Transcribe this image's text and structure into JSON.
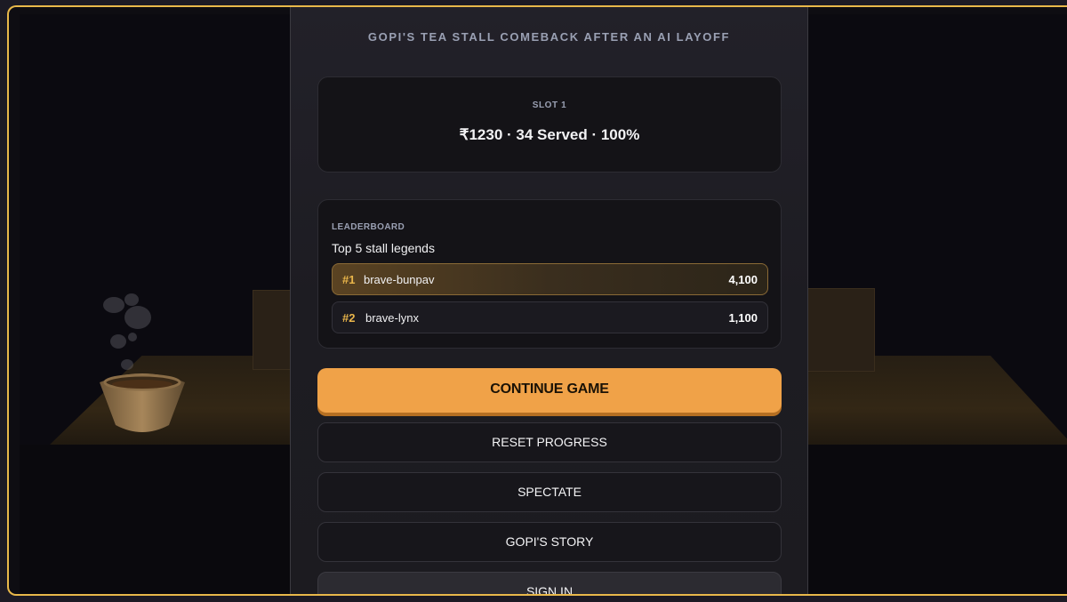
{
  "game": {
    "title": "GOPI'S TEA STALL COMEBACK AFTER AN AI LAYOFF"
  },
  "slot": {
    "label": "SLOT 1",
    "stats": "₹1230 · 34 Served · 100%"
  },
  "leaderboard": {
    "label": "LEADERBOARD",
    "subtitle": "Top 5 stall legends",
    "entries": [
      {
        "rank": "#1",
        "name": "brave-bunpav",
        "score": "4,100"
      },
      {
        "rank": "#2",
        "name": "brave-lynx",
        "score": "1,100"
      }
    ]
  },
  "menu": {
    "continue_label": "CONTINUE GAME",
    "reset_label": "RESET PROGRESS",
    "spectate_label": "SPECTATE",
    "story_label": "GOPI'S STORY",
    "signin_label": "SIGN IN"
  },
  "colors": {
    "accent": "#f0a248",
    "frame_border": "#e8b84a",
    "rank_gold": "#e9b54a"
  }
}
